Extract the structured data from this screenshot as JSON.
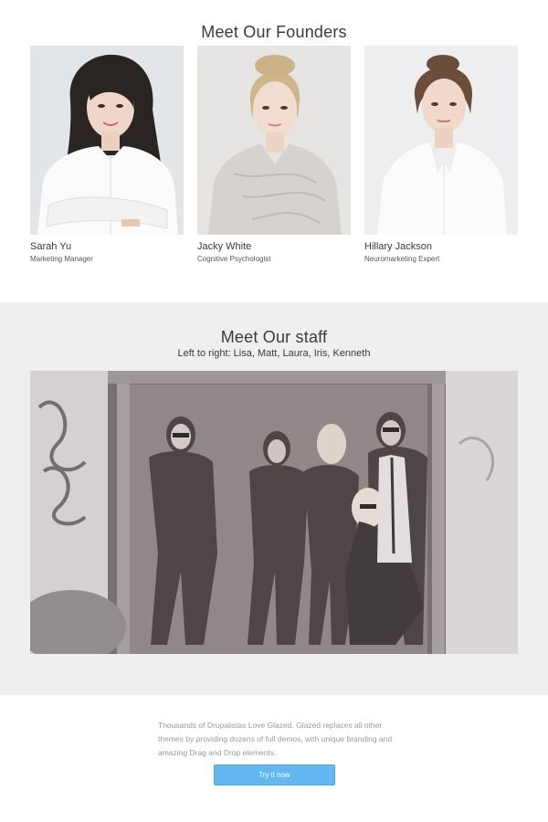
{
  "founders": {
    "title": "Meet Our Founders",
    "people": [
      {
        "name": "Sarah Yu",
        "role": "Marketing Manager"
      },
      {
        "name": "Jacky White",
        "role": "Cognitive Psychologist"
      },
      {
        "name": "Hillary Jackson",
        "role": "Neuromarketing Expert"
      }
    ]
  },
  "staff": {
    "title": "Meet Our staff",
    "subtitle": "Left to right: Lisa, Matt, Laura, Iris, Kenneth"
  },
  "cta": {
    "blurb": "Thousands of Drupalistas Love Glazed. Glazed replaces all other themes by providing dozens of full demos, with unique branding and amazing Drag and Drop elements.",
    "button_label": "Try it now"
  },
  "colors": {
    "button": "#62b8ee",
    "staff_background": "#efefef"
  }
}
